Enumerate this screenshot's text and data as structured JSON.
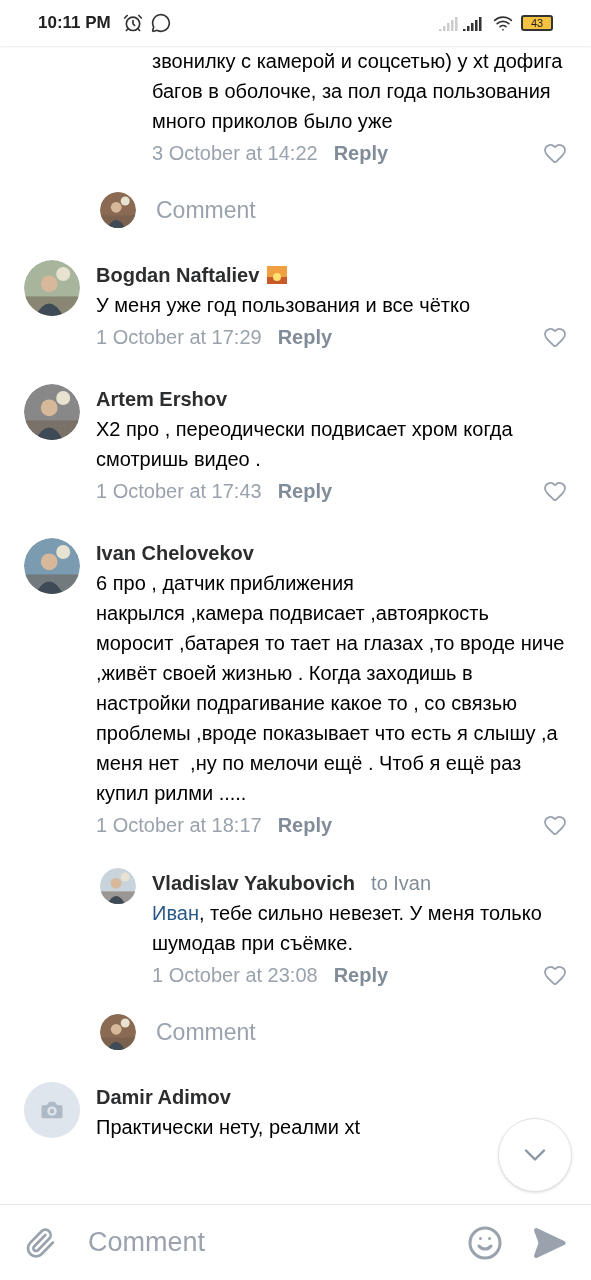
{
  "status_bar": {
    "time": "10:11 PM",
    "battery": "43"
  },
  "threads": [
    {
      "replies": [
        {
          "text": "звонилку с камерой и соцсетью) у xt дофига багов в оболочке, за пол года пользования много приколов было уже",
          "time": "3 October at 14:22",
          "reply": "Reply",
          "liked": false
        }
      ],
      "prompt": "Comment"
    },
    {
      "comment": {
        "author": "Bogdan Naftaliev",
        "badge": true,
        "text": "У меня уже год пользования и все чётко",
        "time": "1 October at 17:29",
        "reply": "Reply",
        "liked": false
      }
    },
    {
      "comment": {
        "author": "Artem Ershov",
        "badge": false,
        "text": "X2 про , переодически подвисает хром когда смотришь видео .",
        "time": "1 October at 17:43",
        "reply": "Reply",
        "liked": false
      }
    },
    {
      "comment": {
        "author": "Ivan Chelovekov",
        "badge": false,
        "text": "6 про , датчик приближения\nнакрылся ,камера подвисает ,автояркость моросит ,батарея то тает на глазах ,то вроде ниче ,живёт своей жизнью . Когда заходишь в настройки подрагивание какое то , со связью проблемы ,вроде показывает что есть я слышу ,а  меня нет  ,ну по мелочи ещё . Чтоб я ещё раз купил рилми .....",
        "time": "1 October at 18:17",
        "reply": "Reply",
        "liked": false
      },
      "replies": [
        {
          "author": "Vladislav Yakubovich",
          "to": "to Ivan",
          "mention": "Иван",
          "text": ", тебе сильно невезет. У меня только шумодав при съёмке.",
          "time": "1 October at 23:08",
          "reply": "Reply",
          "liked": false
        }
      ],
      "prompt": "Comment"
    },
    {
      "comment": {
        "avatar": {
          "kind": "camera"
        },
        "author": "Damir Adimov",
        "badge": false,
        "text": "Практически нету, реалми xt"
      }
    }
  ],
  "composer": {
    "placeholder": "Comment"
  }
}
